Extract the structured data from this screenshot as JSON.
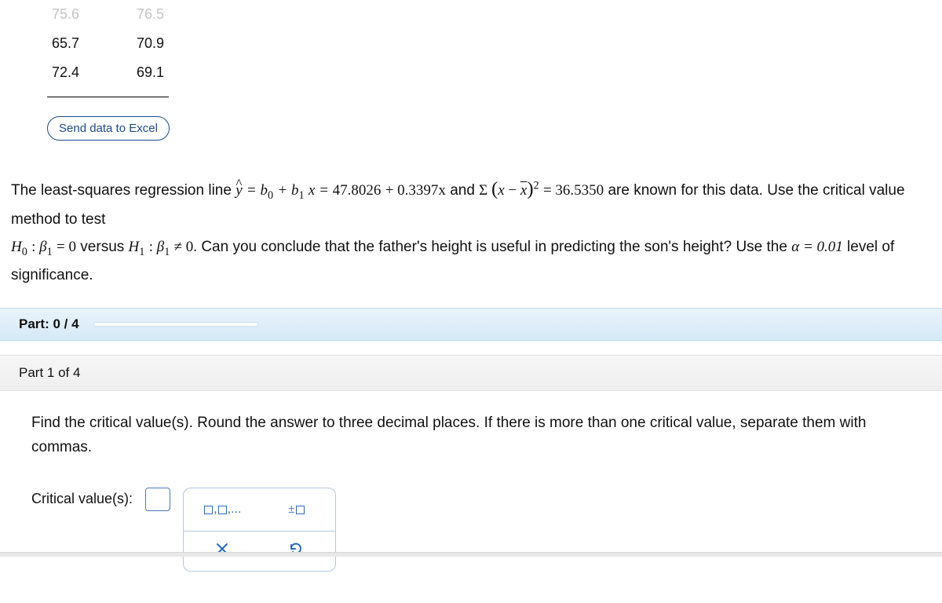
{
  "table": {
    "rows": [
      {
        "c0": "75.6",
        "c1": "76.5"
      },
      {
        "c0": "65.7",
        "c1": "70.9"
      },
      {
        "c0": "72.4",
        "c1": "69.1"
      }
    ]
  },
  "excel_button_label": "Send data to Excel",
  "prompt": {
    "line1_prefix": "The least-squares regression line ",
    "eq_left": "= b",
    "eq_sub0": "0",
    "eq_mid": " + b",
    "eq_sub1": "1",
    "eq_xeq": "x = ",
    "intercept": "47.8026",
    "plus": " + ",
    "slope": "0.3397x",
    "and": " and ",
    "sigma": "Σ ",
    "sum_open": "(x − ",
    "xbar": "x",
    "sum_close": ")",
    "sq_exp": "2",
    "equals": " = ",
    "sumval": "36.5350",
    "line1_suffix": " are known for this data. Use the critical value method to test",
    "line2_prefix": "",
    "h0": "H",
    "h0_sub": "0",
    "colon": " : ",
    "beta": "β",
    "b1sub": "1",
    "eq0": " = 0",
    "versus": " versus ",
    "h1": "H",
    "h1_sub": "1",
    "ne0": " ≠ 0.",
    "line2_q": " Can you conclude that the father's height is useful in predicting the son's height? Use the ",
    "alpha": "α = 0.01",
    "line2_suffix": " level of significance."
  },
  "progress": {
    "label": "Part: 0 / 4",
    "percent": 0
  },
  "part1": {
    "title": "Part 1 of 4",
    "body": "Find the critical value(s). Round the answer to three decimal places. If there is more than one critical value, separate them with commas.",
    "answer_label": "Critical value(s):"
  },
  "toolbox": {
    "list_hint": "□,□,...",
    "pm_hint": "±□"
  }
}
